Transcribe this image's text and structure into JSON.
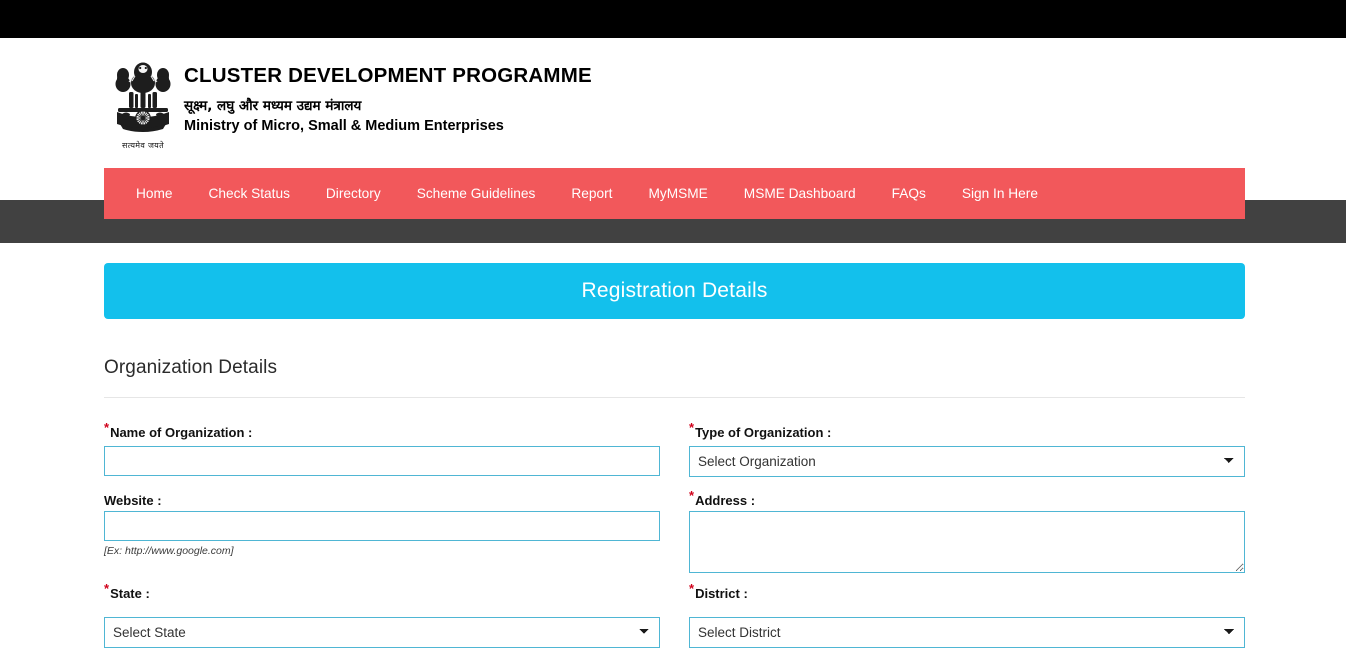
{
  "header": {
    "title_main": "CLUSTER DEVELOPMENT PROGRAMME",
    "title_hindi": "सूक्ष्म, लघु और मध्यम उद्यम मंत्रालय",
    "title_sub": "Ministry of Micro, Small & Medium Enterprises",
    "emblem_motto": "सत्यमेव जयते"
  },
  "nav": {
    "items": [
      {
        "label": "Home"
      },
      {
        "label": "Check Status"
      },
      {
        "label": "Directory"
      },
      {
        "label": "Scheme Guidelines"
      },
      {
        "label": "Report"
      },
      {
        "label": "MyMSME"
      },
      {
        "label": "MSME Dashboard"
      },
      {
        "label": "FAQs"
      },
      {
        "label": "Sign In Here"
      }
    ]
  },
  "banner": {
    "title": "Registration Details"
  },
  "section": {
    "title": "Organization Details"
  },
  "form": {
    "name_of_organization": {
      "label": "Name of Organization :",
      "required": true,
      "value": "",
      "placeholder": ""
    },
    "type_of_organization": {
      "label": "Type of Organization :",
      "required": true,
      "selected": "Select Organization",
      "options": [
        "Select Organization"
      ]
    },
    "website": {
      "label": "Website :",
      "required": false,
      "value": "",
      "placeholder": "",
      "hint": "[Ex: http://www.google.com]"
    },
    "address": {
      "label": "Address :",
      "required": true,
      "value": "",
      "placeholder": ""
    },
    "state": {
      "label": "State :",
      "required": true,
      "selected": "Select State",
      "options": [
        "Select State"
      ]
    },
    "district": {
      "label": "District :",
      "required": true,
      "selected": "Select District",
      "options": [
        "Select District"
      ]
    }
  },
  "colors": {
    "nav_red": "#F2585B",
    "nav_dark": "#414141",
    "banner_cyan": "#13C0EC",
    "input_border": "#4FB6D4",
    "required_asterisk": "#D0021B",
    "topbar_black": "#000000"
  }
}
